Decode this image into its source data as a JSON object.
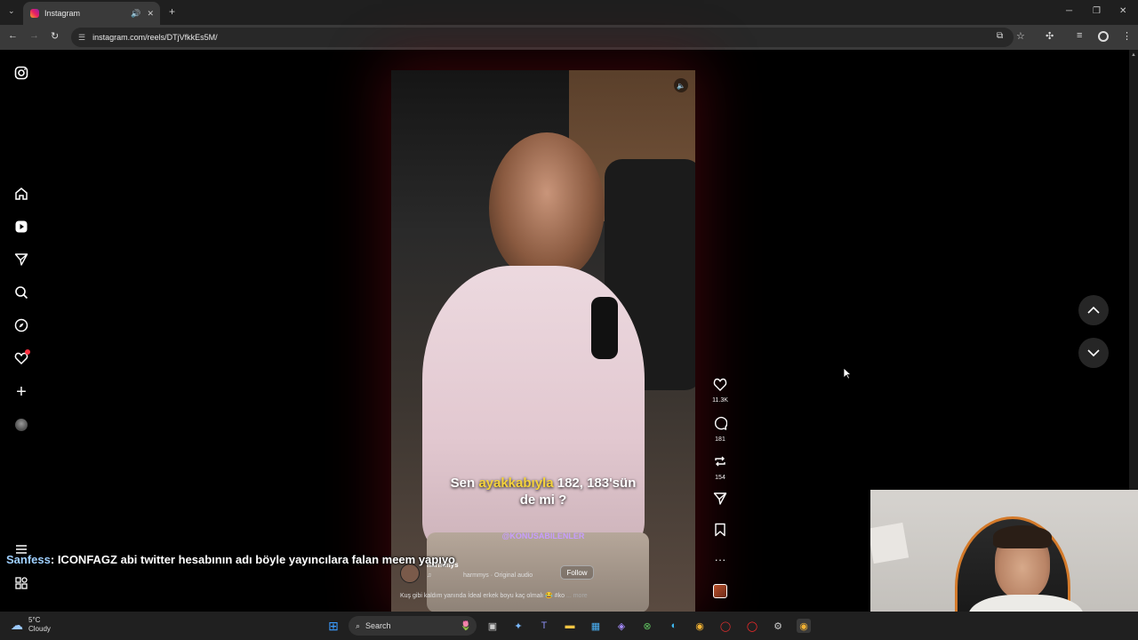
{
  "browser": {
    "tab_title": "Instagram",
    "url": "instagram.com/reels/DTjVfkkEs5M/"
  },
  "sidebar": {
    "items": [
      {
        "icon": "instagram-logo-icon"
      },
      {
        "icon": "home-icon"
      },
      {
        "icon": "reels-icon"
      },
      {
        "icon": "messages-icon"
      },
      {
        "icon": "search-icon"
      },
      {
        "icon": "explore-icon"
      },
      {
        "icon": "notifications-icon"
      },
      {
        "icon": "create-icon"
      },
      {
        "icon": "profile-avatar"
      },
      {
        "icon": "more-menu-icon"
      },
      {
        "icon": "also-from-meta-icon"
      }
    ]
  },
  "reel": {
    "subtitle_pre": "Sen ",
    "subtitle_highlight": "ayakkabıyla",
    "subtitle_post": " 182, 183'sün",
    "subtitle_line2": "de mi ?",
    "brand_tag": "@KONUSABILENLER",
    "author": "harmmys",
    "audio": "harmmys · Original audio",
    "follow_label": "Follow",
    "caption": "Kuş gibi kaldım yanında İdeal erkek boyu kaç olmalı 😂 #ko",
    "more_label": "... more"
  },
  "actions": {
    "likes": "11.3K",
    "comments": "181",
    "reposts": "154"
  },
  "chat": {
    "user": "Sanfess",
    "message": ": ICONFAGZ abi twitter hesabının adı böyle yayıncılara falan meem yapıyo"
  },
  "taskbar": {
    "temperature": "5°C",
    "condition": "Cloudy",
    "search_label": "Search"
  },
  "colors": {
    "subtitle_highlight": "#f4d23c",
    "brand_tag": "#c79dff",
    "chat_user": "#9fd0ff",
    "notification_dot": "#ff3040"
  }
}
